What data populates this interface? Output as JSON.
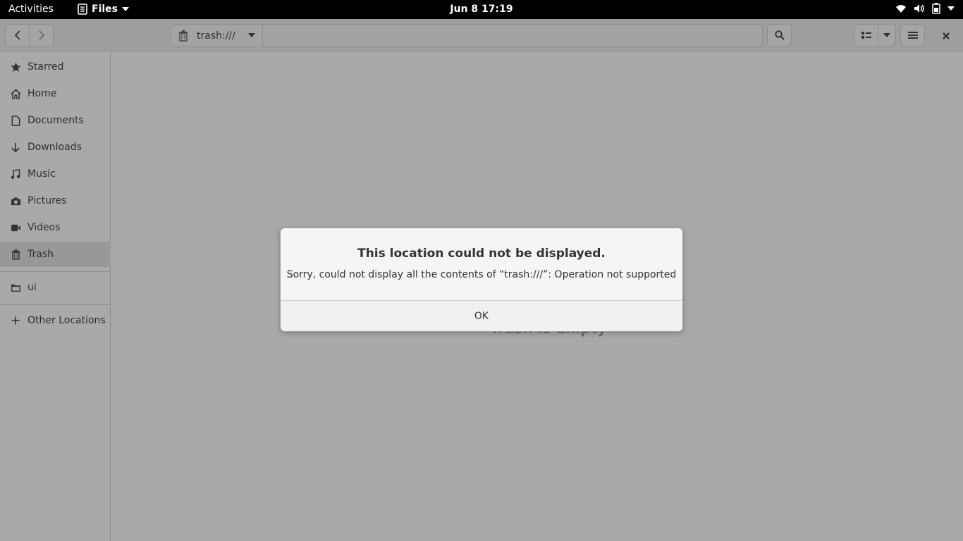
{
  "topbar": {
    "activities": "Activities",
    "app_name": "Files",
    "clock": "Jun 8  17:19"
  },
  "header": {
    "path": "trash:///"
  },
  "sidebar": {
    "items": [
      {
        "label": "Starred",
        "icon": "star-icon"
      },
      {
        "label": "Home",
        "icon": "home-icon"
      },
      {
        "label": "Documents",
        "icon": "document-icon"
      },
      {
        "label": "Downloads",
        "icon": "download-icon"
      },
      {
        "label": "Music",
        "icon": "music-icon"
      },
      {
        "label": "Pictures",
        "icon": "camera-icon"
      },
      {
        "label": "Videos",
        "icon": "video-icon"
      },
      {
        "label": "Trash",
        "icon": "trash-icon",
        "active": true
      },
      {
        "label": "ui",
        "icon": "folder-icon"
      },
      {
        "label": "Other Locations",
        "icon": "plus-icon"
      }
    ]
  },
  "content": {
    "empty_label": "Trash is Empty"
  },
  "dialog": {
    "title": "This location could not be displayed.",
    "message": "Sorry, could not display all the contents of “trash:///”: Operation not supported",
    "ok_label": "OK"
  }
}
